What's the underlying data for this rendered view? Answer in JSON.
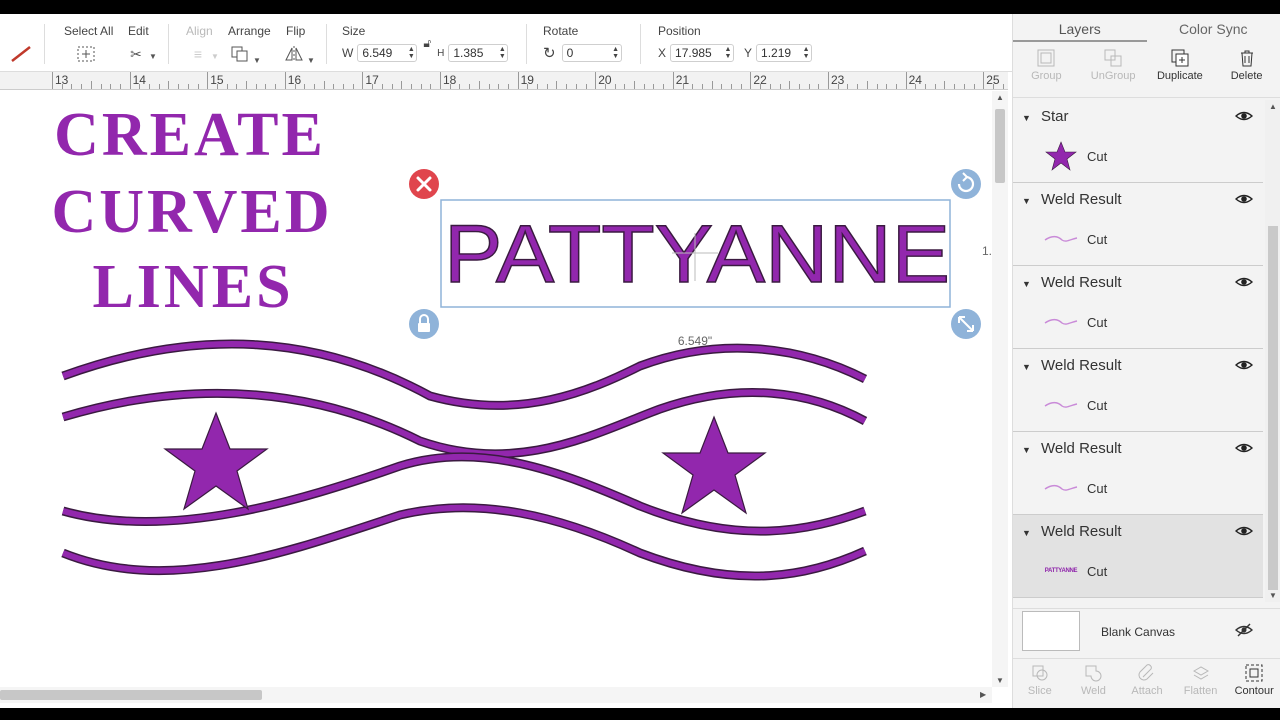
{
  "toolbar": {
    "select_all_label": "Select All",
    "edit_label": "Edit",
    "align_label": "Align",
    "arrange_label": "Arrange",
    "flip_label": "Flip",
    "size_label": "Size",
    "size_w_prefix": "W",
    "size_w_value": "6.549",
    "size_h_prefix": "H",
    "size_h_value": "1.385",
    "rotate_label": "Rotate",
    "rotate_value": "0",
    "position_label": "Position",
    "pos_x_prefix": "X",
    "pos_x_value": "17.985",
    "pos_y_prefix": "Y",
    "pos_y_value": "1.219"
  },
  "ruler": {
    "numbers": [
      "13",
      "14",
      "15",
      "16",
      "17",
      "18",
      "19",
      "20",
      "21",
      "22",
      "23",
      "24",
      "25"
    ]
  },
  "canvas": {
    "title_lines": [
      "CREATE",
      "CURVED",
      "LINES"
    ],
    "selected_text": "PATTYANNE",
    "width_readout": "6.549\"",
    "height_readout": "1.",
    "accent_color": "#9227ad",
    "outline_color": "#3a1a40",
    "selection_color": "#8fb3d9",
    "delete_color": "#e0454d"
  },
  "panel": {
    "tabs": [
      "Layers",
      "Color Sync"
    ],
    "actions": [
      {
        "label": "Group",
        "enabled": false,
        "icon": "group-icon"
      },
      {
        "label": "UnGroup",
        "enabled": false,
        "icon": "ungroup-icon"
      },
      {
        "label": "Duplicate",
        "enabled": true,
        "icon": "duplicate-icon"
      },
      {
        "label": "Delete",
        "enabled": true,
        "icon": "trash-icon"
      }
    ],
    "layers": [
      {
        "name": "Star",
        "operation": "Cut",
        "thumb": "star"
      },
      {
        "name": "Weld Result",
        "operation": "Cut",
        "thumb": "curve"
      },
      {
        "name": "Weld Result",
        "operation": "Cut",
        "thumb": "curve"
      },
      {
        "name": "Weld Result",
        "operation": "Cut",
        "thumb": "curve"
      },
      {
        "name": "Weld Result",
        "operation": "Cut",
        "thumb": "curve"
      },
      {
        "name": "Weld Result",
        "operation": "Cut",
        "thumb": "text",
        "thumb_text": "PATTYANNE"
      }
    ],
    "blank_canvas_label": "Blank Canvas",
    "bottom_actions": [
      {
        "label": "Slice",
        "enabled": false
      },
      {
        "label": "Weld",
        "enabled": false
      },
      {
        "label": "Attach",
        "enabled": false
      },
      {
        "label": "Flatten",
        "enabled": false
      },
      {
        "label": "Contour",
        "enabled": true
      }
    ]
  }
}
